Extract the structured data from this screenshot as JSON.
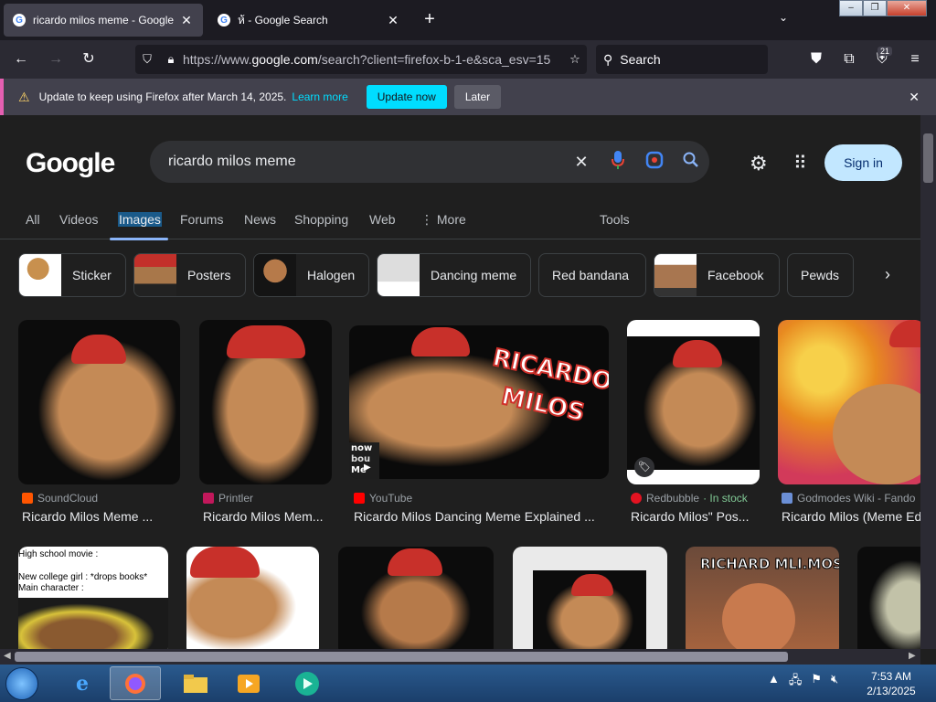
{
  "tabs": [
    {
      "title": "ricardo milos meme - Google Se",
      "active": true
    },
    {
      "title": "ห้ - Google Search",
      "active": false
    }
  ],
  "nav": {
    "url_prefix": "https://www.",
    "url_host": "google.com",
    "url_rest": "/search?client=firefox-b-1-e&sca_esv=15",
    "search_placeholder": "Search",
    "ext_badge": "21"
  },
  "notification": {
    "message": "Update to keep using Firefox after March 14, 2025.",
    "learn_more": "Learn more",
    "update_label": "Update now",
    "later_label": "Later"
  },
  "google": {
    "logo": "Google",
    "query": "ricardo milos meme",
    "signin_label": "Sign in",
    "tabs": [
      "All",
      "Videos",
      "Images",
      "Forums",
      "News",
      "Shopping",
      "Web",
      "More",
      "Tools"
    ],
    "chips": [
      "Sticker",
      "Posters",
      "Halogen",
      "Dancing meme",
      "Red bandana",
      "Facebook",
      "Pewds"
    ],
    "results_row1": [
      {
        "source": "SoundCloud",
        "caption": "Ricardo Milos Meme ...",
        "color": "#ff5500"
      },
      {
        "source": "Printler",
        "caption": "Ricardo Milos Mem...",
        "color": "#c2185b"
      },
      {
        "source": "YouTube",
        "caption": "Ricardo Milos Dancing Meme Explained ...",
        "color": "#ff0000"
      },
      {
        "source": "Redbubble",
        "stock": "· In stock",
        "caption": "Ricardo Milos\" Pos...",
        "color": "#e41321"
      },
      {
        "source": "Godmodes Wiki - Fando",
        "caption": "Ricardo Milos (Meme Ed",
        "color": "#6b8fd6"
      }
    ],
    "overlay_ricardo": "RICARDO",
    "overlay_milos": "MILOS",
    "overlay_know": "now",
    "overlay_bou": "bou",
    "overlay_meme": "Me",
    "overlay_hs1": "High school movie :",
    "overlay_hs2": "New college girl : *drops books*",
    "overlay_hs3": "Main character :",
    "overlay_richard": "RICHARD MLI.MOS"
  },
  "taskbar": {
    "time": "7:53 AM",
    "date": "2/13/2025"
  }
}
